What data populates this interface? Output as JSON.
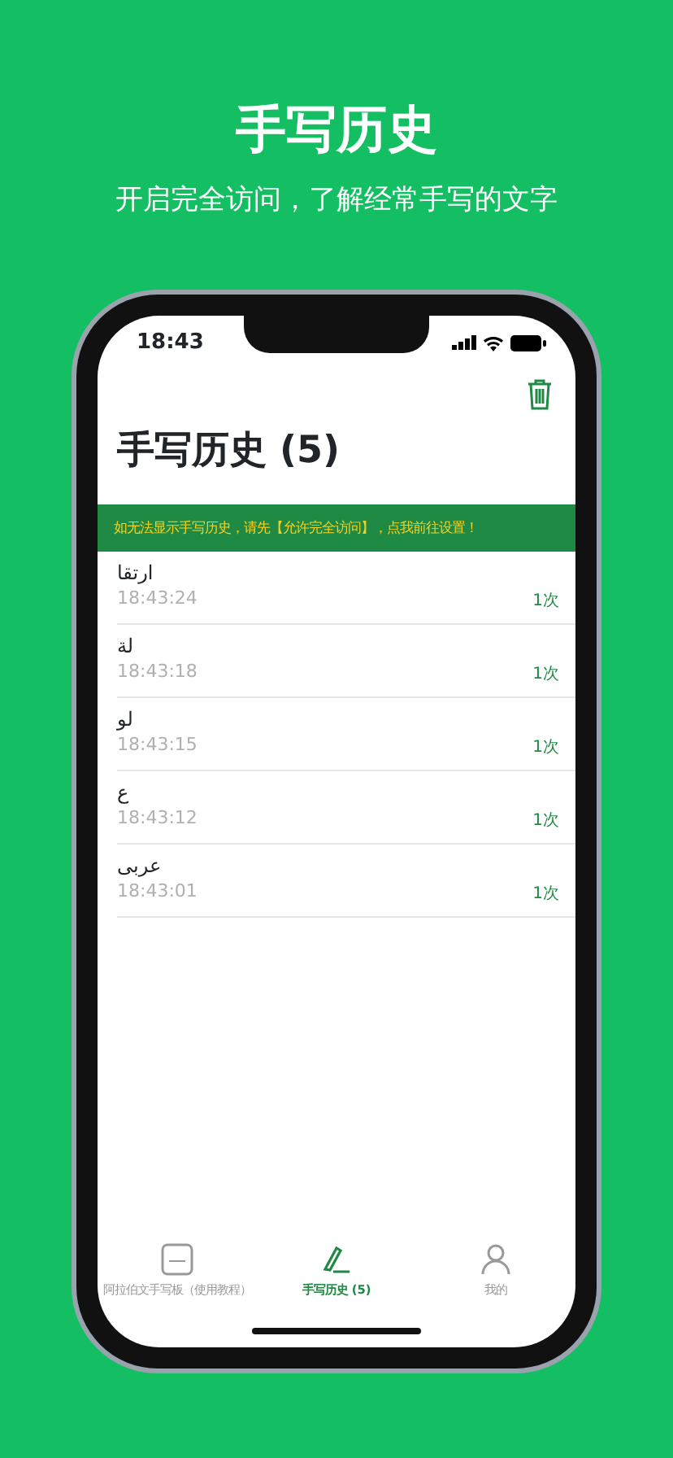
{
  "promo": {
    "title": "手写历史",
    "subtitle": "开启完全访问，了解经常手写的文字"
  },
  "status_bar": {
    "time": "18:43"
  },
  "page": {
    "title": "手写历史 (5)"
  },
  "notice": "如无法显示手写历史，请先【允许完全访问】，点我前往设置！",
  "history": [
    {
      "text": "ارتقا",
      "time": "18:43:24",
      "count": "1次"
    },
    {
      "text": "لة",
      "time": "18:43:18",
      "count": "1次"
    },
    {
      "text": "لو",
      "time": "18:43:15",
      "count": "1次"
    },
    {
      "text": "ع",
      "time": "18:43:12",
      "count": "1次"
    },
    {
      "text": "عربى",
      "time": "18:43:01",
      "count": "1次"
    }
  ],
  "tab_bar": [
    {
      "label": "阿拉伯文手写板（使用教程）",
      "kind": "keyboard",
      "selected": false
    },
    {
      "label": "手写历史 (5)",
      "kind": "pen",
      "selected": true
    },
    {
      "label": "我的",
      "kind": "person",
      "selected": false
    }
  ]
}
